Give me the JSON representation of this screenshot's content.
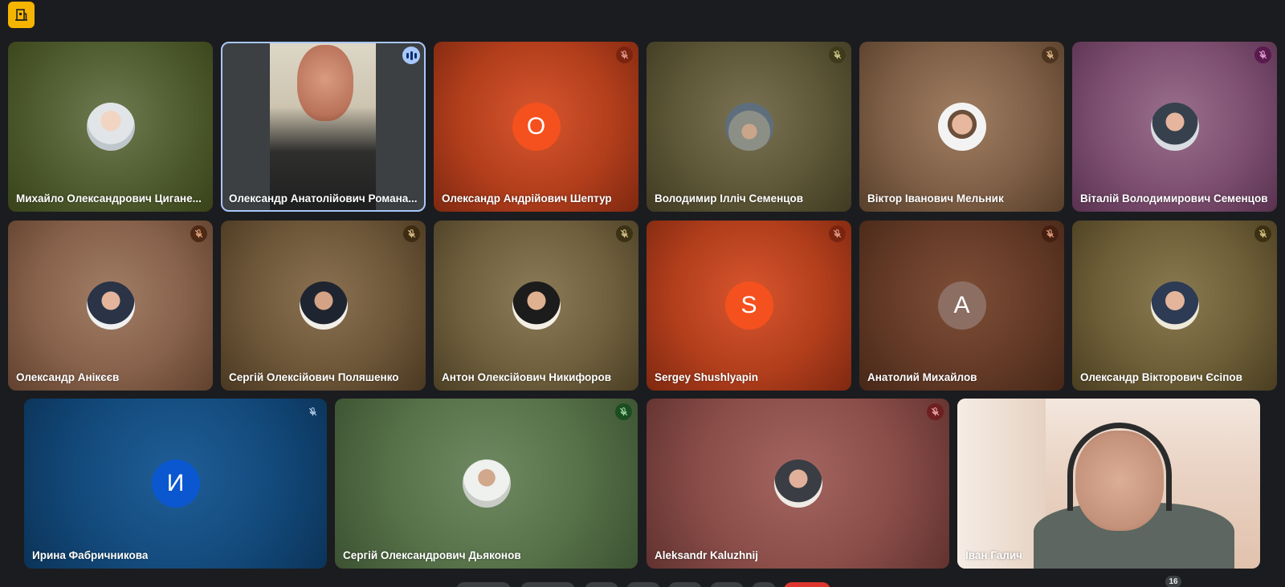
{
  "app": {
    "accent": "#f5b400",
    "logo_icon": "building-icon"
  },
  "participants": [
    {
      "name": "Михайло Олександрович Циганенко",
      "display_name": "Михайло Олександрович Цигане...",
      "mic": "muted-hidden",
      "tile": "photo-avatar"
    },
    {
      "name": "Олександр Анатолійович Романа...",
      "display_name": "Олександр Анатолійович Романа...",
      "mic": "speaking",
      "tile": "video"
    },
    {
      "name": "Олександр Андрійович Шептур",
      "display_name": "Олександр Андрійович Шептур",
      "mic": "muted",
      "tile": "letter",
      "letter": "О"
    },
    {
      "name": "Володимир Ілліч Семенцов",
      "display_name": "Володимир Ілліч Семенцов",
      "mic": "muted",
      "tile": "photo-avatar"
    },
    {
      "name": "Віктор Іванович Мельник",
      "display_name": "Віктор Іванович Мельник",
      "mic": "muted",
      "tile": "photo-avatar"
    },
    {
      "name": "Віталій Володимирович Семенцов",
      "display_name": "Віталій Володимирович Семенцов",
      "mic": "muted",
      "tile": "photo-avatar"
    },
    {
      "name": "Олександр Анікєєв",
      "display_name": "Олександр Анікєєв",
      "mic": "muted",
      "tile": "photo-avatar"
    },
    {
      "name": "Сергій Олексійович Поляшенко",
      "display_name": "Сергій Олексійович Поляшенко",
      "mic": "muted",
      "tile": "photo-avatar"
    },
    {
      "name": "Антон Олексійович Никифоров",
      "display_name": "Антон Олексійович Никифоров",
      "mic": "muted",
      "tile": "photo-avatar"
    },
    {
      "name": "Sergey Shushlyapin",
      "display_name": "Sergey Shushlyapin",
      "mic": "muted",
      "tile": "letter",
      "letter": "S"
    },
    {
      "name": "Анатолий Михайлов",
      "display_name": "Анатолий Михайлов",
      "mic": "muted",
      "tile": "letter",
      "letter": "A"
    },
    {
      "name": "Олександр Вікторович Єсіпов",
      "display_name": "Олександр Вікторович Єсіпов",
      "mic": "muted",
      "tile": "photo-avatar"
    },
    {
      "name": "Ирина Фабричникова",
      "display_name": "Ирина Фабричникова",
      "mic": "muted",
      "tile": "letter",
      "letter": "И"
    },
    {
      "name": "Сергій Олександрович Дьяконов",
      "display_name": "Сергій Олександрович Дьяконов",
      "mic": "muted",
      "tile": "photo-avatar"
    },
    {
      "name": "Aleksandr Kaluzhnij",
      "display_name": "Aleksandr Kaluzhnij",
      "mic": "muted",
      "tile": "photo-avatar"
    },
    {
      "name": "Іван Галич",
      "display_name": "Іван Галич",
      "mic": "none",
      "tile": "video"
    }
  ],
  "participant_count": "16",
  "colors": {
    "speaking_ring": "#a8c7fa",
    "letter_orange": "#f4511e",
    "letter_gray": "#8d6e63",
    "letter_blue": "#0b57d0"
  }
}
